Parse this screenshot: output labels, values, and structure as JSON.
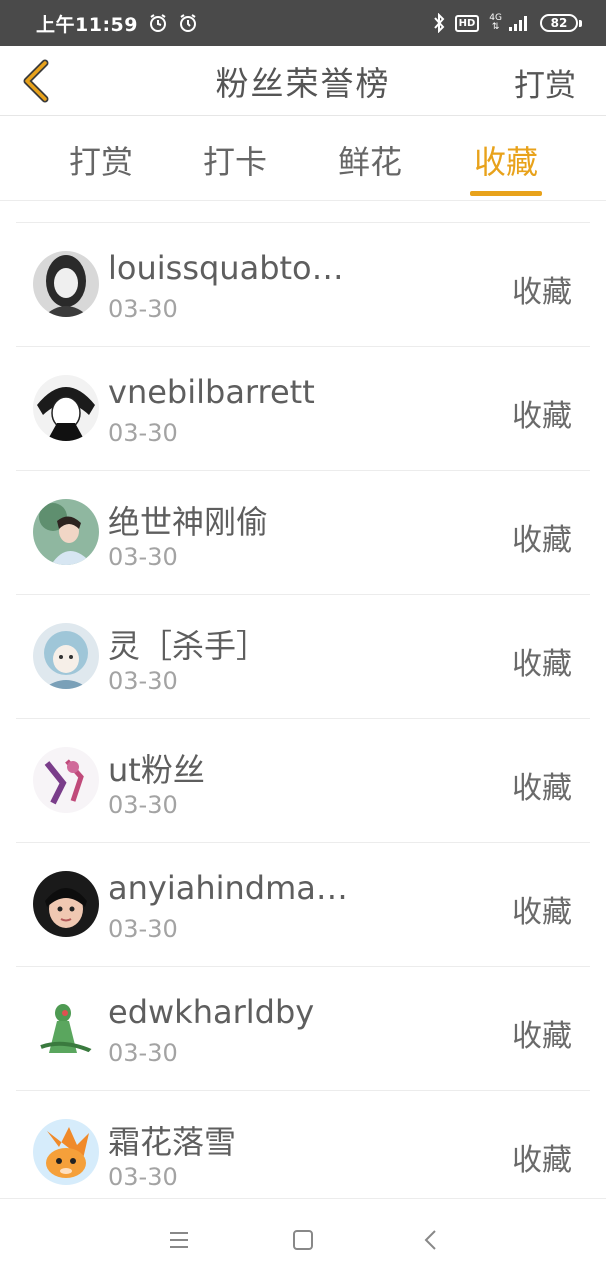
{
  "status_bar": {
    "time": "上午11:59",
    "hd": "HD",
    "network": "4G",
    "battery": "82"
  },
  "header": {
    "title": "粉丝荣誉榜",
    "action": "打赏"
  },
  "tabs": [
    {
      "label": "打赏"
    },
    {
      "label": "打卡"
    },
    {
      "label": "鲜花"
    },
    {
      "label": "收藏",
      "active": true
    }
  ],
  "list": [
    {
      "name": "louissquabto…",
      "date": "03-30",
      "type": "收藏"
    },
    {
      "name": "vnebilbarrett",
      "date": "03-30",
      "type": "收藏"
    },
    {
      "name": "绝世神刚偷",
      "date": "03-30",
      "type": "收藏"
    },
    {
      "name": "灵［杀手］",
      "date": "03-30",
      "type": "收藏"
    },
    {
      "name": "ut粉丝",
      "date": "03-30",
      "type": "收藏"
    },
    {
      "name": "anyiahindma…",
      "date": "03-30",
      "type": "收藏"
    },
    {
      "name": "edwkharldby",
      "date": "03-30",
      "type": "收藏"
    },
    {
      "name": "霜花落雪",
      "date": "03-30",
      "type": "收藏"
    }
  ],
  "colors": {
    "accent": "#e8a21b",
    "status_bar_bg": "#4a4a4a",
    "text_primary": "#5e5e5e",
    "text_secondary": "#a3a3a3"
  }
}
